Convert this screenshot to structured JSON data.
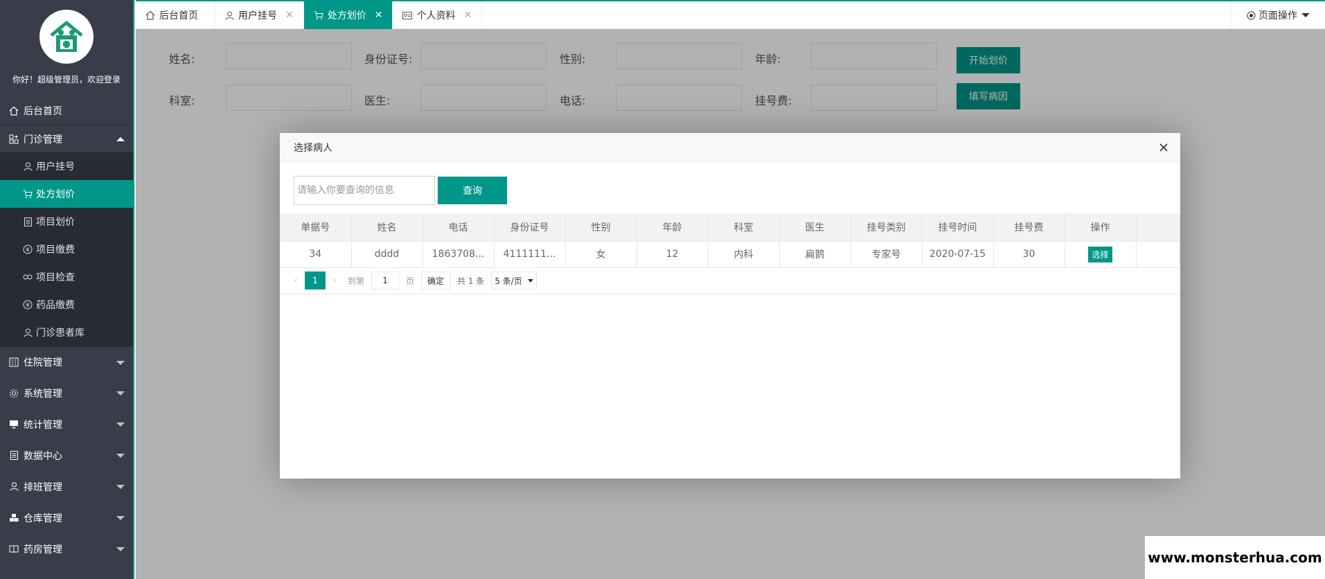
{
  "sidebar": {
    "welcome": "你好！超级管理员，欢迎登录",
    "home": "后台首页",
    "outpatient": {
      "label": "门诊管理",
      "items": [
        "用户挂号",
        "处方划价",
        "项目划价",
        "项目缴费",
        "项目检查",
        "药品缴费",
        "门诊患者库"
      ]
    },
    "sections": [
      "住院管理",
      "系统管理",
      "统计管理",
      "数据中心",
      "排班管理",
      "仓库管理",
      "药房管理"
    ]
  },
  "tabs": [
    {
      "label": "后台首页"
    },
    {
      "label": "用户挂号"
    },
    {
      "label": "处方划价"
    },
    {
      "label": "个人资料"
    }
  ],
  "page_ops": "页面操作",
  "form": {
    "name": "姓名:",
    "idcard": "身份证号:",
    "gender": "性别:",
    "age": "年龄:",
    "start_btn": "开始划价",
    "dept": "科室:",
    "doctor": "医生:",
    "phone": "电话:",
    "fee": "挂号费:",
    "cause_btn": "填写病因"
  },
  "modal": {
    "title": "选择病人",
    "search_placeholder": "请输入你要查询的信息",
    "search_btn": "查询",
    "columns": [
      "单据号",
      "姓名",
      "电话",
      "身份证号",
      "性别",
      "年龄",
      "科室",
      "医生",
      "挂号类别",
      "挂号时间",
      "挂号费",
      "操作"
    ],
    "rows": [
      {
        "id": "34",
        "name": "dddd",
        "phone": "1863708...",
        "idcard": "4111111...",
        "gender": "女",
        "age": "12",
        "dept": "内科",
        "doctor": "扁鹊",
        "type": "专家号",
        "time": "2020-07-15",
        "fee": "30",
        "action": "选择"
      }
    ],
    "pager": {
      "current": "1",
      "goto": "到第",
      "page_value": "1",
      "page_unit": "页",
      "ok": "确定",
      "total": "共 1 条",
      "size": "5 条/页"
    }
  },
  "watermark": "www.monsterhua.com",
  "colors": {
    "accent": "#009688",
    "sidebar": "#393d49",
    "sidebar_sub": "#282b33"
  }
}
